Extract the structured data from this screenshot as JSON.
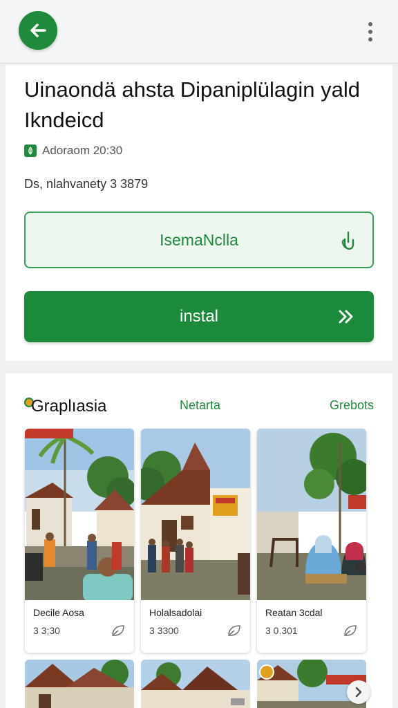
{
  "header": {
    "back_icon": "arrow-left-icon",
    "more_icon": "more-vertical-icon",
    "accent": "#1f8a3c"
  },
  "app": {
    "title": "Uinaondä  ahsta  Dipaniplülagin yald Ikndeicd",
    "meta": "Adoraom 20:30",
    "meta_icon": "verified-badge-icon",
    "subline": "Ds, nlahvanety 3 3879"
  },
  "actions": {
    "secondary_label": "IsemaNclla",
    "secondary_icon": "touch-icon",
    "install_label": "instal",
    "install_icon": "double-chevron-right-icon"
  },
  "gallery": {
    "title": "Graplıasia",
    "tabs": [
      {
        "label": "Netarta"
      },
      {
        "label": "Grebots"
      }
    ],
    "items": [
      {
        "name": "Decile Aosa",
        "count": "3 3;30",
        "icon": "leaf-icon"
      },
      {
        "name": "Holalsadolai",
        "count": "3 3300",
        "icon": "leaf-icon"
      },
      {
        "name": "Reatan 3cdal",
        "count": "3 0.301",
        "icon": "leaf-icon"
      }
    ],
    "next_icon": "chevron-right-icon"
  }
}
